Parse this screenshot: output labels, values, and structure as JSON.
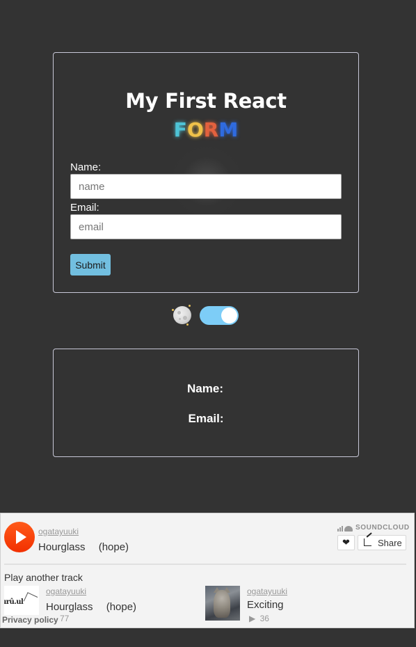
{
  "form": {
    "title": "My First React",
    "subtitle_letters": [
      "F",
      "O",
      "R",
      "M"
    ],
    "name_label": "Name:",
    "name_placeholder": "name",
    "email_label": "Email:",
    "email_placeholder": "email",
    "submit_label": "Submit"
  },
  "theme_toggle": {
    "icon": "moon-icon",
    "state": "on",
    "track_color": "#7dcdf7"
  },
  "result": {
    "name_label": "Name:",
    "email_label": "Email:"
  },
  "soundcloud": {
    "brand": "SOUNDCLOUD",
    "current": {
      "uploader": "ogatayuuki",
      "title": "Hourglass 　(hope)"
    },
    "share_label": "Share",
    "another_label": "Play another track",
    "tracks": [
      {
        "uploader": "ogatayuuki",
        "title": "Hourglass 　(hope)",
        "plays": "77",
        "thumb_text": "urû.ul"
      },
      {
        "uploader": "ogatayuuki",
        "title": "Exciting",
        "plays": "36"
      }
    ],
    "privacy_label": "Privacy policy",
    "accent": "#ff5500"
  }
}
